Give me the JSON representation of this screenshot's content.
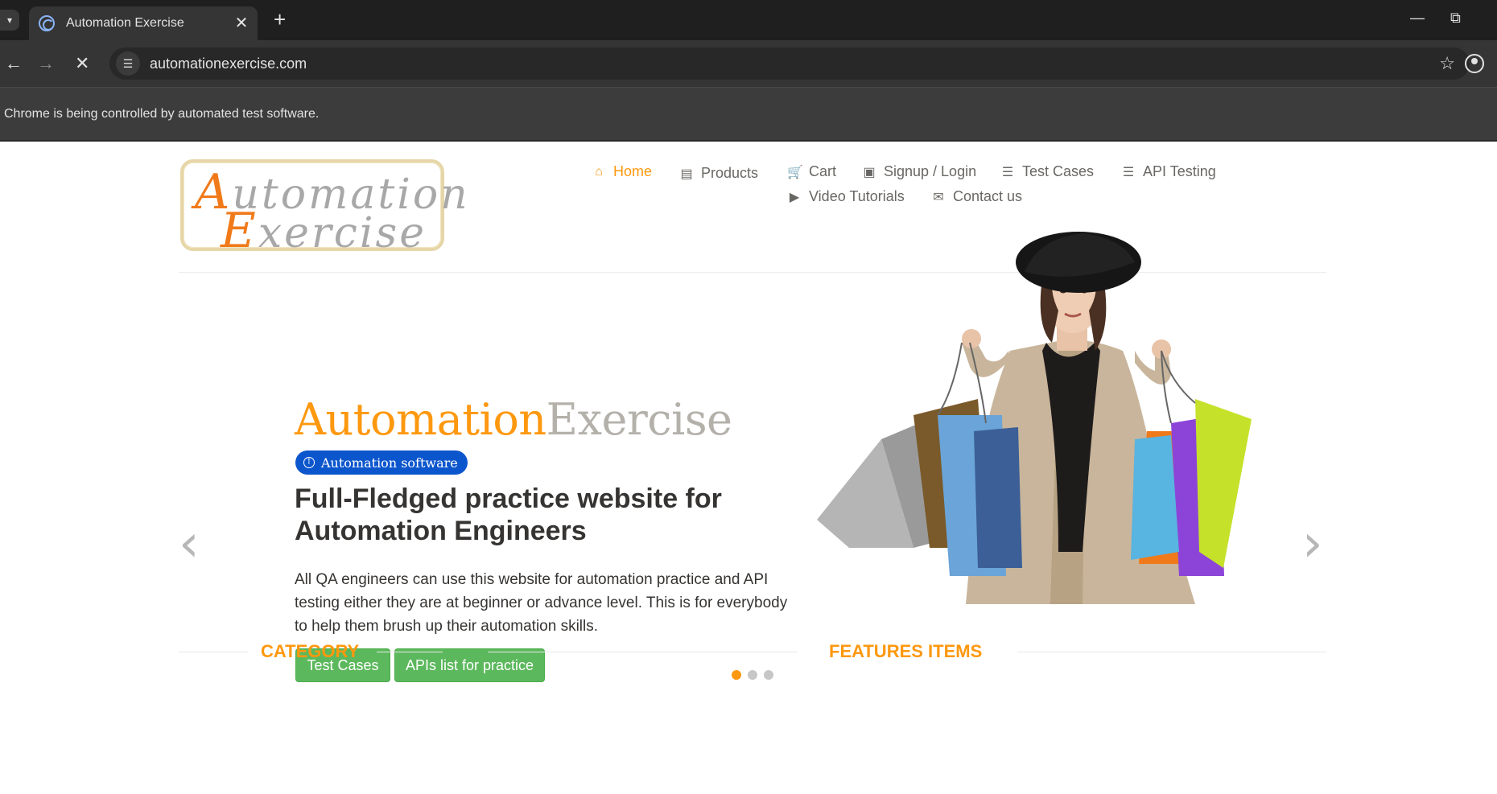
{
  "browser": {
    "tab_title": "Automation Exercise",
    "url": "automationexercise.com",
    "infobar": "Chrome is being controlled by automated test software."
  },
  "logo": {
    "line1_cap": "A",
    "line1_rest": "utomation",
    "line2_cap": "E",
    "line2_rest": "xercise"
  },
  "nav": {
    "items": [
      {
        "label": "Home",
        "icon": "home-icon",
        "active": true
      },
      {
        "label": "Products",
        "icon": "briefcase-icon"
      },
      {
        "label": "Cart",
        "icon": "cart-icon"
      },
      {
        "label": "Signup / Login",
        "icon": "lock-icon"
      },
      {
        "label": "Test Cases",
        "icon": "list-icon"
      },
      {
        "label": "API Testing",
        "icon": "list-icon"
      },
      {
        "label": "Video Tutorials",
        "icon": "youtube-play-icon"
      },
      {
        "label": "Contact us",
        "icon": "envelope-icon"
      }
    ]
  },
  "slider": {
    "brand_part1": "Automation",
    "brand_part2": "Exercise",
    "badge": "Automation software",
    "headline": "Full-Fledged practice website for Automation Engineers",
    "description": "All QA engineers can use this website for automation practice and API testing either they are at beginner or advance level. This is for everybody to help them brush up their automation skills.",
    "button_test_cases": "Test Cases",
    "button_apis": "APIs list for practice",
    "active_slide": 1,
    "slide_count": 3
  },
  "sections": {
    "category": "CATEGORY",
    "features": "FEATURES ITEMS"
  },
  "colors": {
    "accent": "#fe980f",
    "button_green": "#5cb85c",
    "badge_blue": "#0c56cd",
    "text_dark": "#363432",
    "nav_text": "#696763"
  }
}
